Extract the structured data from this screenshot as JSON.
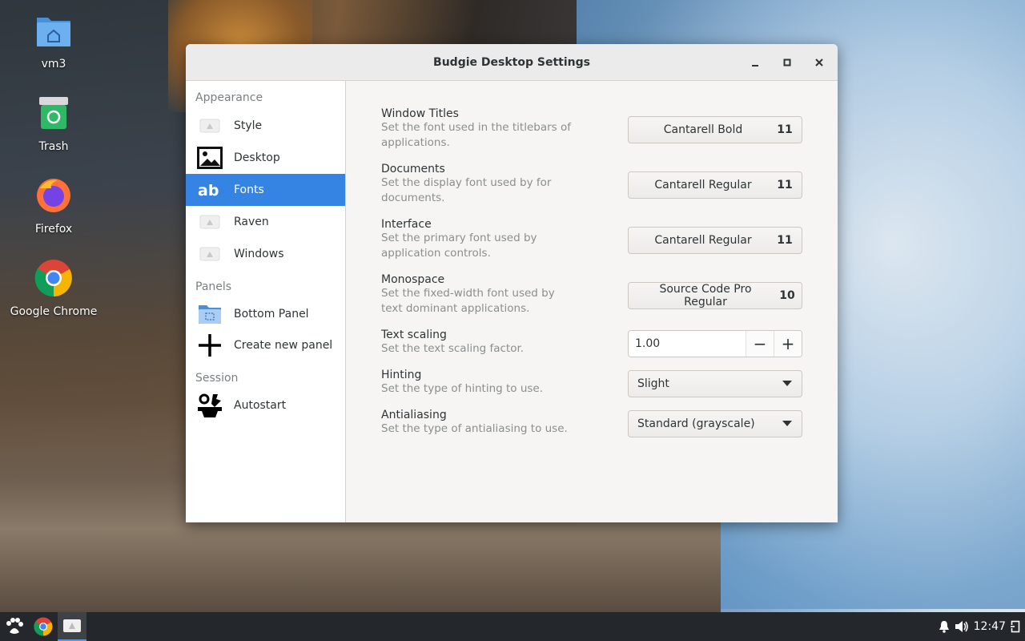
{
  "window": {
    "title": "Budgie Desktop Settings"
  },
  "desktop_icons": [
    {
      "label": "vm3",
      "icon": "home-folder-icon"
    },
    {
      "label": "Trash",
      "icon": "trash-icon"
    },
    {
      "label": "Firefox",
      "icon": "firefox-icon"
    },
    {
      "label": "Google Chrome",
      "icon": "chrome-icon"
    }
  ],
  "sidebar": {
    "sections": [
      {
        "heading": "Appearance"
      },
      {
        "heading": "Panels"
      },
      {
        "heading": "Session"
      }
    ],
    "items": [
      {
        "label": "Style",
        "icon": "style-placeholder-icon"
      },
      {
        "label": "Desktop",
        "icon": "desktop-image-icon"
      },
      {
        "label": "Fonts",
        "icon": "fonts-ab-icon",
        "active": true
      },
      {
        "label": "Raven",
        "icon": "raven-placeholder-icon"
      },
      {
        "label": "Windows",
        "icon": "windows-placeholder-icon"
      },
      {
        "label": "Bottom Panel",
        "icon": "panel-folder-icon"
      },
      {
        "label": "Create new panel",
        "icon": "plus-icon"
      },
      {
        "label": "Autostart",
        "icon": "autostart-tools-icon"
      }
    ]
  },
  "settings": [
    {
      "title": "Window Titles",
      "desc": "Set the font used in the titlebars of applications.",
      "font": "Cantarell Bold",
      "size": "11"
    },
    {
      "title": "Documents",
      "desc": "Set the display font used by for documents.",
      "font": "Cantarell Regular",
      "size": "11"
    },
    {
      "title": "Interface",
      "desc": "Set the primary font used by application controls.",
      "font": "Cantarell Regular",
      "size": "11"
    },
    {
      "title": "Monospace",
      "desc": "Set the fixed-width font used by text dominant applications.",
      "font": "Source Code Pro Regular",
      "size": "10"
    },
    {
      "title": "Text scaling",
      "desc": "Set the text scaling factor.",
      "value": "1.00",
      "minus": "−",
      "plus": "+"
    },
    {
      "title": "Hinting",
      "desc": "Set the type of hinting to use.",
      "selected": "Slight"
    },
    {
      "title": "Antialiasing",
      "desc": "Set the type of antialiasing to use.",
      "selected": "Standard (grayscale)"
    }
  ],
  "taskbar": {
    "clock": "12:47"
  },
  "colors": {
    "accent": "#3584e4",
    "taskbar": "#24272b"
  }
}
